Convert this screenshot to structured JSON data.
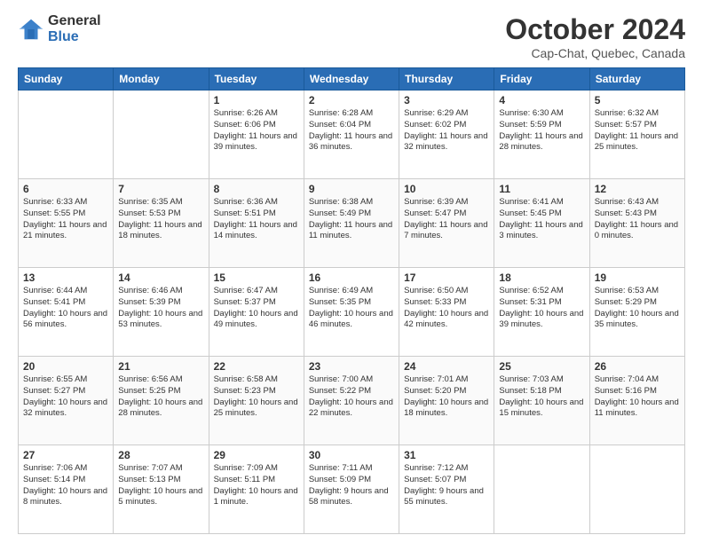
{
  "header": {
    "logo_general": "General",
    "logo_blue": "Blue",
    "month": "October 2024",
    "location": "Cap-Chat, Quebec, Canada"
  },
  "days": [
    "Sunday",
    "Monday",
    "Tuesday",
    "Wednesday",
    "Thursday",
    "Friday",
    "Saturday"
  ],
  "weeks": [
    [
      {
        "day": "",
        "info": ""
      },
      {
        "day": "",
        "info": ""
      },
      {
        "day": "1",
        "info": "Sunrise: 6:26 AM\nSunset: 6:06 PM\nDaylight: 11 hours and 39 minutes."
      },
      {
        "day": "2",
        "info": "Sunrise: 6:28 AM\nSunset: 6:04 PM\nDaylight: 11 hours and 36 minutes."
      },
      {
        "day": "3",
        "info": "Sunrise: 6:29 AM\nSunset: 6:02 PM\nDaylight: 11 hours and 32 minutes."
      },
      {
        "day": "4",
        "info": "Sunrise: 6:30 AM\nSunset: 5:59 PM\nDaylight: 11 hours and 28 minutes."
      },
      {
        "day": "5",
        "info": "Sunrise: 6:32 AM\nSunset: 5:57 PM\nDaylight: 11 hours and 25 minutes."
      }
    ],
    [
      {
        "day": "6",
        "info": "Sunrise: 6:33 AM\nSunset: 5:55 PM\nDaylight: 11 hours and 21 minutes."
      },
      {
        "day": "7",
        "info": "Sunrise: 6:35 AM\nSunset: 5:53 PM\nDaylight: 11 hours and 18 minutes."
      },
      {
        "day": "8",
        "info": "Sunrise: 6:36 AM\nSunset: 5:51 PM\nDaylight: 11 hours and 14 minutes."
      },
      {
        "day": "9",
        "info": "Sunrise: 6:38 AM\nSunset: 5:49 PM\nDaylight: 11 hours and 11 minutes."
      },
      {
        "day": "10",
        "info": "Sunrise: 6:39 AM\nSunset: 5:47 PM\nDaylight: 11 hours and 7 minutes."
      },
      {
        "day": "11",
        "info": "Sunrise: 6:41 AM\nSunset: 5:45 PM\nDaylight: 11 hours and 3 minutes."
      },
      {
        "day": "12",
        "info": "Sunrise: 6:43 AM\nSunset: 5:43 PM\nDaylight: 11 hours and 0 minutes."
      }
    ],
    [
      {
        "day": "13",
        "info": "Sunrise: 6:44 AM\nSunset: 5:41 PM\nDaylight: 10 hours and 56 minutes."
      },
      {
        "day": "14",
        "info": "Sunrise: 6:46 AM\nSunset: 5:39 PM\nDaylight: 10 hours and 53 minutes."
      },
      {
        "day": "15",
        "info": "Sunrise: 6:47 AM\nSunset: 5:37 PM\nDaylight: 10 hours and 49 minutes."
      },
      {
        "day": "16",
        "info": "Sunrise: 6:49 AM\nSunset: 5:35 PM\nDaylight: 10 hours and 46 minutes."
      },
      {
        "day": "17",
        "info": "Sunrise: 6:50 AM\nSunset: 5:33 PM\nDaylight: 10 hours and 42 minutes."
      },
      {
        "day": "18",
        "info": "Sunrise: 6:52 AM\nSunset: 5:31 PM\nDaylight: 10 hours and 39 minutes."
      },
      {
        "day": "19",
        "info": "Sunrise: 6:53 AM\nSunset: 5:29 PM\nDaylight: 10 hours and 35 minutes."
      }
    ],
    [
      {
        "day": "20",
        "info": "Sunrise: 6:55 AM\nSunset: 5:27 PM\nDaylight: 10 hours and 32 minutes."
      },
      {
        "day": "21",
        "info": "Sunrise: 6:56 AM\nSunset: 5:25 PM\nDaylight: 10 hours and 28 minutes."
      },
      {
        "day": "22",
        "info": "Sunrise: 6:58 AM\nSunset: 5:23 PM\nDaylight: 10 hours and 25 minutes."
      },
      {
        "day": "23",
        "info": "Sunrise: 7:00 AM\nSunset: 5:22 PM\nDaylight: 10 hours and 22 minutes."
      },
      {
        "day": "24",
        "info": "Sunrise: 7:01 AM\nSunset: 5:20 PM\nDaylight: 10 hours and 18 minutes."
      },
      {
        "day": "25",
        "info": "Sunrise: 7:03 AM\nSunset: 5:18 PM\nDaylight: 10 hours and 15 minutes."
      },
      {
        "day": "26",
        "info": "Sunrise: 7:04 AM\nSunset: 5:16 PM\nDaylight: 10 hours and 11 minutes."
      }
    ],
    [
      {
        "day": "27",
        "info": "Sunrise: 7:06 AM\nSunset: 5:14 PM\nDaylight: 10 hours and 8 minutes."
      },
      {
        "day": "28",
        "info": "Sunrise: 7:07 AM\nSunset: 5:13 PM\nDaylight: 10 hours and 5 minutes."
      },
      {
        "day": "29",
        "info": "Sunrise: 7:09 AM\nSunset: 5:11 PM\nDaylight: 10 hours and 1 minute."
      },
      {
        "day": "30",
        "info": "Sunrise: 7:11 AM\nSunset: 5:09 PM\nDaylight: 9 hours and 58 minutes."
      },
      {
        "day": "31",
        "info": "Sunrise: 7:12 AM\nSunset: 5:07 PM\nDaylight: 9 hours and 55 minutes."
      },
      {
        "day": "",
        "info": ""
      },
      {
        "day": "",
        "info": ""
      }
    ]
  ]
}
